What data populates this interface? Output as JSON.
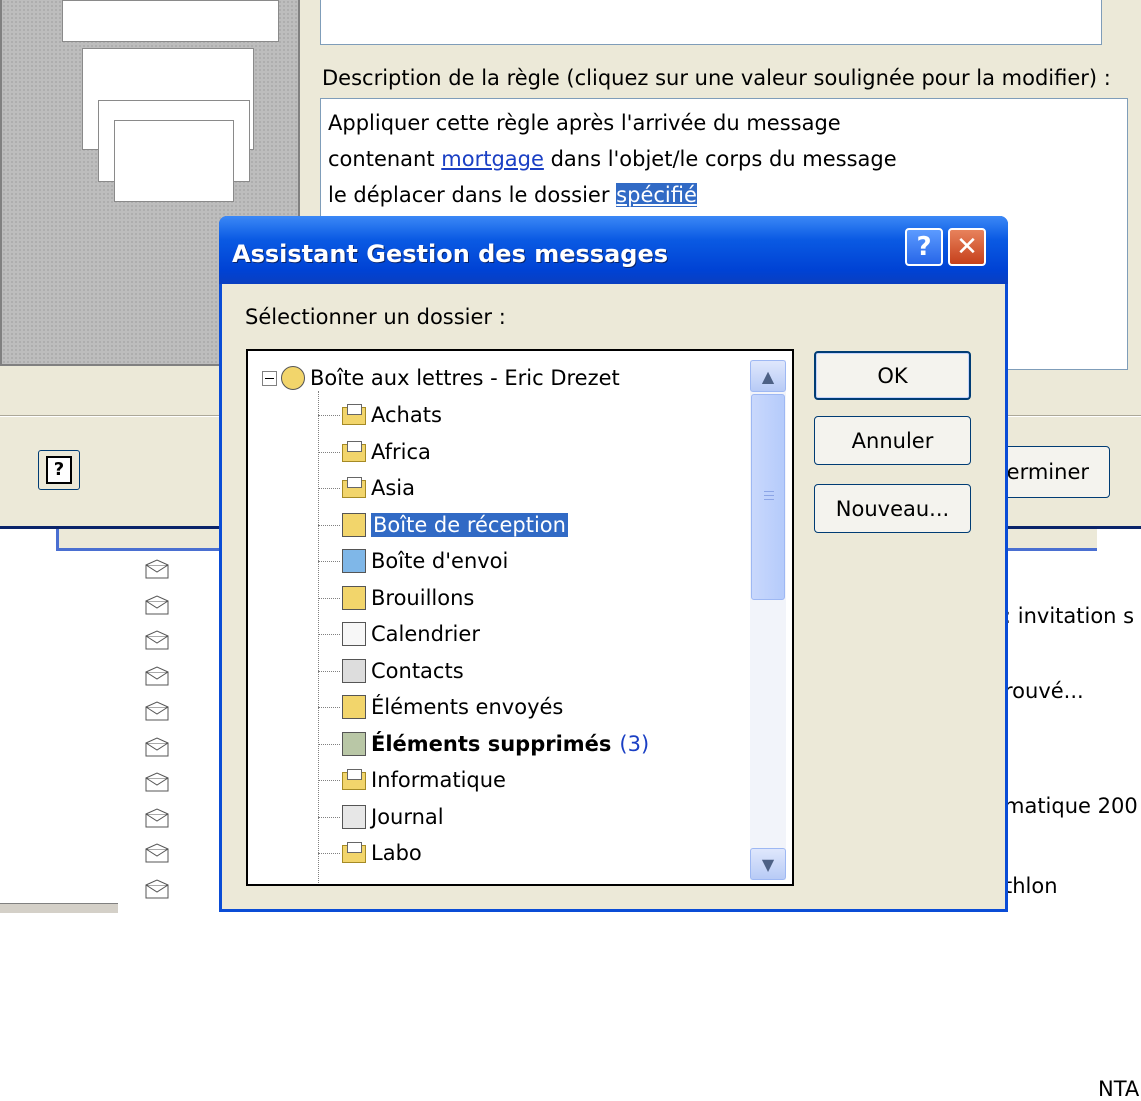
{
  "rules_wizard": {
    "description_label": "Description de la règle (cliquez sur une valeur soulignée pour la modifier) :",
    "description_lines": [
      {
        "before": "Appliquer cette règle après l'arrivée du message"
      },
      {
        "before": "contenant ",
        "link": "mortgage",
        "after": " dans l'objet/le corps du message"
      },
      {
        "before": "le déplacer dans le dossier ",
        "link": "spécifié"
      }
    ],
    "finish_button_partial": "erminer"
  },
  "folder_dialog": {
    "title": "Assistant Gestion des messages",
    "help_glyph": "?",
    "close_glyph": "✕",
    "select_label": "Sélectionner un dossier :",
    "root": "Boîte aux lettres - Eric Drezet",
    "folders": [
      {
        "label": "Achats",
        "icon": "mail-folder-icon"
      },
      {
        "label": "Africa",
        "icon": "mail-folder-icon"
      },
      {
        "label": "Asia",
        "icon": "mail-folder-icon"
      },
      {
        "label": "Boîte de réception",
        "icon": "inbox-icon",
        "selected": true
      },
      {
        "label": "Boîte d'envoi",
        "icon": "outbox-icon"
      },
      {
        "label": "Brouillons",
        "icon": "drafts-icon"
      },
      {
        "label": "Calendrier",
        "icon": "calendar-icon"
      },
      {
        "label": "Contacts",
        "icon": "contacts-icon"
      },
      {
        "label": "Éléments envoyés",
        "icon": "sent-items-icon"
      },
      {
        "label": "Éléments supprimés",
        "icon": "deleted-items-icon",
        "bold": true,
        "count": "(3)"
      },
      {
        "label": "Informatique",
        "icon": "mail-folder-icon"
      },
      {
        "label": "Journal",
        "icon": "journal-icon"
      },
      {
        "label": "Labo",
        "icon": "mail-folder-icon"
      }
    ],
    "buttons": {
      "ok": "OK",
      "cancel": "Annuler",
      "new": "Nouveau..."
    }
  },
  "background_list": {
    "snippets": [
      ": invitation s",
      "rouvé...",
      "matique 200",
      "thlon"
    ],
    "top_snippet": "NTA"
  }
}
